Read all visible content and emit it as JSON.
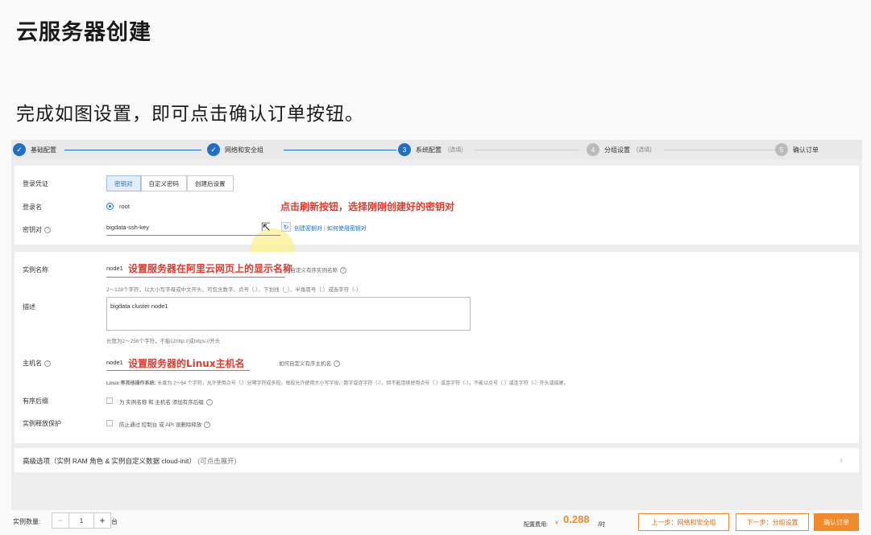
{
  "slide": {
    "title": "云服务器创建",
    "subtitle": "完成如图设置，即可点击确认订单按钮。"
  },
  "steps": [
    {
      "num": "✓",
      "label": "基础配置",
      "state": "done"
    },
    {
      "num": "✓",
      "label": "网络和安全组",
      "state": "done"
    },
    {
      "num": "3",
      "label": "系统配置",
      "optional": "(选填)",
      "state": "current"
    },
    {
      "num": "4",
      "label": "分组设置",
      "optional": "(选填)",
      "state": "todo"
    },
    {
      "num": "5",
      "label": "确认订单",
      "state": "todo"
    }
  ],
  "login": {
    "credential_label": "登录凭证",
    "tabs": [
      "密钥对",
      "自定义密码",
      "创建后设置"
    ],
    "active_tab": 0,
    "username_label": "登录名",
    "username_value": "root",
    "keypair_label": "密钥对",
    "keypair_value": "bigdata-ssh-key",
    "create_keypair": "创建密钥对",
    "separator": "|",
    "how_to_use": "如何使用密钥对",
    "annotation": "点击刷新按钮，选择刚刚创建好的密钥对"
  },
  "instance": {
    "name_label": "实例名称",
    "name_value": "node1",
    "name_annotation": "设置服务器在阿里云网页上的显示名称",
    "name_help": "何自定义有序实例名称",
    "name_rule": "2～128个字符，以大小写字母或中文开头，可包含数字、点号（.）、下划线（_）、半角冒号（:）或连字符（-）",
    "desc_label": "描述",
    "desc_value": "bigdata cluster node1",
    "desc_rule": "长度为2～256个字符，不能以http://或https://开头",
    "host_label": "主机名",
    "host_value": "node1",
    "host_annotation": "设置服务器的Linux主机名",
    "host_help": "如何自定义有序主机名",
    "host_rule_bold": "Linux 等其他操作系统:",
    "host_rule": "长度为 2～64 个字符，允许使用点号（.）分隔字符成多段，每段允许使用大小写字母、数字或连字符（-），但不能连续使用点号（.）或连字符（-）。不能以点号（.）或连字符（-）开头或结尾。",
    "suffix_label": "有序后缀",
    "suffix_text": "为 实例名称 和 主机名 添加有序后缀",
    "protect_label": "实例释放保护",
    "protect_text": "防止通过 控制台 或 API 误删除释放"
  },
  "advanced": {
    "label": "高级选项（实例 RAM 角色 & 实例自定义数据 cloud-init）",
    "hint": "(可点击展开)"
  },
  "footer": {
    "qty_label": "实例数量:",
    "qty_value": "1",
    "qty_unit": "台",
    "cost_label": "配置费用:",
    "currency": "¥",
    "price": "0.288",
    "price_unit": "/时",
    "prev_button": "上一步：网络和安全组",
    "next_button": "下一步：分组设置",
    "confirm_button": "确认订单"
  },
  "colors": {
    "accent_blue": "#1f6fc7",
    "accent_orange": "#f08a2b",
    "annotation_red": "#e03c2e"
  }
}
